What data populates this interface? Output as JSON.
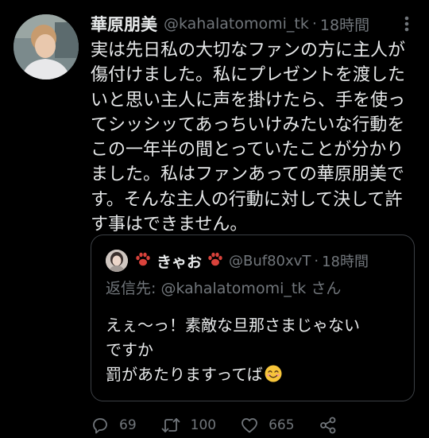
{
  "tweet": {
    "author_name": "華原朋美",
    "handle": "@kahalatomomi_tk",
    "dot": "·",
    "time": "18時間",
    "text": "実は先日私の大切なファンの方に主人が\n傷付けました。私にプレゼントを渡した\nいと思い主人に声を掛けたら、手を使っ\nてシッシッてあっちいけみたいな行動を\nこの一年半の間とっていたことが分かり\nました。私はファンあっての華原朋美で\nす。そんな主人の行動に対して決して許\nす事はできません。"
  },
  "quote": {
    "author_name": "きゃお",
    "handle": "@Buf80xvT",
    "dot": "·",
    "time": "18時間",
    "reply_to": "返信先: @kahalatomomi_tk さん",
    "text": "えぇ〜っ！素敵な旦那さまじゃない\nですか\n罰があたりますってば",
    "emoji": "smiling-face-emoji"
  },
  "actions": {
    "replies": "69",
    "retweets": "100",
    "likes": "665"
  },
  "colors": {
    "background": "#000000",
    "text": "#e7e9ea",
    "secondary": "#71767b",
    "border": "#3b3f44",
    "paw": "#d9423b"
  }
}
